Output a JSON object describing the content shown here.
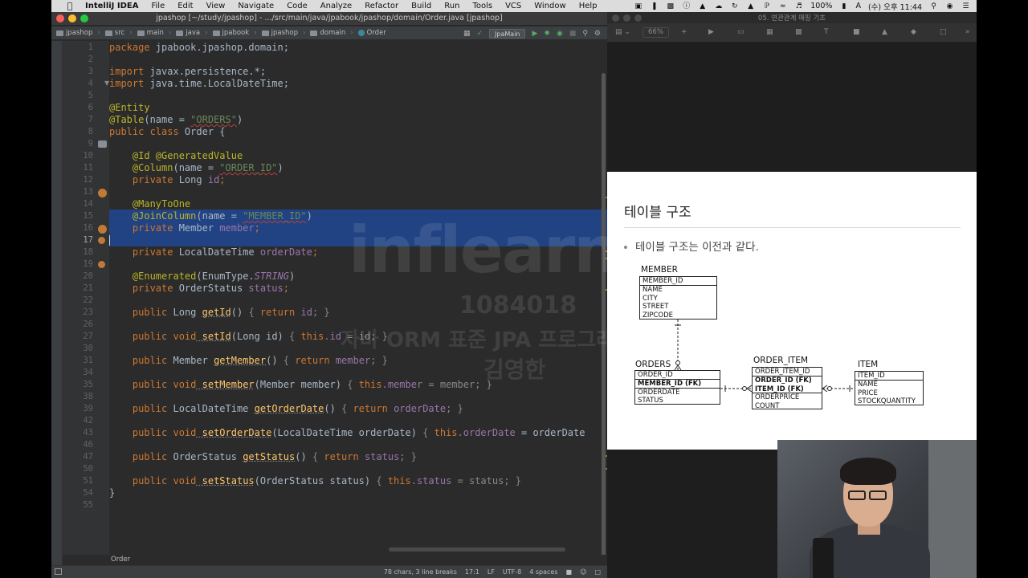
{
  "menubar": {
    "app_name": "IntelliJ IDEA",
    "items": [
      "File",
      "Edit",
      "View",
      "Navigate",
      "Code",
      "Analyze",
      "Refactor",
      "Build",
      "Run",
      "Tools",
      "VCS",
      "Window",
      "Help"
    ],
    "battery": "100%",
    "input_method": "A",
    "clock": "(수) 오후 11:44"
  },
  "ide": {
    "title": "jpashop [~/study/jpashop] - .../src/main/java/jpabook/jpashop/domain/Order.java [jpashop]",
    "breadcrumbs": [
      "jpashop",
      "src",
      "main",
      "java",
      "jpabook",
      "jpashop",
      "domain",
      "Order"
    ],
    "run_config": "JpaMain",
    "tab_label": "Order",
    "status": {
      "selection": "78 chars, 3 line breaks",
      "position": "17:1",
      "line_sep": "LF",
      "encoding": "UTF-8",
      "indent": "4 spaces"
    },
    "line_numbers": [
      "1",
      "2",
      "3",
      "4",
      "5",
      "6",
      "7",
      "8",
      "9",
      "10",
      "11",
      "12",
      "13",
      "14",
      "15",
      "16",
      "17",
      "18",
      "19",
      "20",
      "21",
      "22",
      "23",
      "26",
      "27",
      "30",
      "31",
      "34",
      "35",
      "38",
      "39",
      "42",
      "43",
      "46",
      "47",
      "50",
      "51",
      "54",
      "55"
    ]
  },
  "code": {
    "l1_kw": "package",
    "l1_rest": " jpabook.jpashop.domain;",
    "l3_kw": "import",
    "l3_rest": " javax.persistence.*;",
    "l4_kw": "import",
    "l4_rest": " java.time.LocalDateTime;",
    "l6": "@Entity",
    "l7_ann": "@Table",
    "l7_a": "(name = ",
    "l7_str": "\"ORDERS\"",
    "l7_b": ")",
    "l8_kw": "public class",
    "l8_rest": " Order {",
    "l10": "@Id @GeneratedValue",
    "l11_ann": "@Column",
    "l11_a": "(name = ",
    "l11_str": "\"ORDER_ID\"",
    "l11_b": ")",
    "l12_kw": "private",
    "l12_type": " Long ",
    "l12_f": "id",
    "l12_end": ";",
    "l14": "@ManyToOne",
    "l15_ann": "@JoinColumn",
    "l15_a": "(name = ",
    "l15_str": "\"MEMBER_ID\"",
    "l15_b": ")",
    "l16_kw": "private",
    "l16_type": " Member ",
    "l16_f": "member",
    "l16_end": ";",
    "l18_kw": "private",
    "l18_type": " LocalDateTime ",
    "l18_f": "orderDate",
    "l18_end": ";",
    "l20_ann": "@Enumerated",
    "l20_a": "(EnumType.",
    "l20_const": "STRING",
    "l20_b": ")",
    "l21_kw": "private",
    "l21_type": " OrderStatus ",
    "l21_f": "status",
    "l21_end": ";",
    "g1_kw": "public",
    "g1_type": " Long ",
    "g1_m": "getId",
    "g1_a": "() ",
    "g1_o": "{ ",
    "g1_kw2": "return",
    "g1_f": " id",
    "g1_c": "; }",
    "s1_kw": "public void",
    "s1_m": " setId",
    "s1_a": "(Long id) ",
    "s1_o": "{ ",
    "s1_kw2": "this",
    "s1_f": ".id",
    "s1_c": " = id; }",
    "g2_kw": "public",
    "g2_type": " Member ",
    "g2_m": "getMember",
    "g2_a": "() ",
    "g2_o": "{ ",
    "g2_kw2": "return",
    "g2_f": " member",
    "g2_c": "; }",
    "s2_kw": "public void",
    "s2_m": " setMember",
    "s2_a": "(Member member) ",
    "s2_o": "{ ",
    "s2_kw2": "this",
    "s2_f": ".member",
    "s2_c": " = member; }",
    "g3_kw": "public",
    "g3_type": " LocalDateTime ",
    "g3_m": "getOrderDate",
    "g3_a": "() ",
    "g3_o": "{ ",
    "g3_kw2": "return",
    "g3_f": " orderDate",
    "g3_c": "; }",
    "s3_kw": "public void",
    "s3_m": " setOrderDate",
    "s3_a": "(LocalDateTime orderDate) ",
    "s3_o": "{ ",
    "s3_kw2": "this",
    "s3_f": ".orderDate",
    "s3_c": " = orderDate",
    "g4_kw": "public",
    "g4_type": " OrderStatus ",
    "g4_m": "getStatus",
    "g4_a": "() ",
    "g4_o": "{ ",
    "g4_kw2": "return",
    "g4_f": " status",
    "g4_c": "; }",
    "s4_kw": "public void",
    "s4_m": " setStatus",
    "s4_a": "(OrderStatus status) ",
    "s4_o": "{ ",
    "s4_kw2": "this",
    "s4_f": ".status",
    "s4_c": " = status; }",
    "close": "}"
  },
  "watermark": {
    "logo": "inflearn",
    "number": "1084018",
    "course": "자바 ORM 표준 JPA 프로그래밍 - 기본편",
    "name": "김영한"
  },
  "keynote": {
    "window_title": "05. 연관관계 매핑 기초",
    "zoom": "66%",
    "slide": {
      "title": "테이블 구조",
      "bullet": "테이블 구조는 이전과 같다.",
      "entities": {
        "member": {
          "title": "MEMBER",
          "pk": "MEMBER_ID",
          "cols": [
            "NAME",
            "CITY",
            "STREET",
            "ZIPCODE"
          ]
        },
        "orders": {
          "title": "ORDERS",
          "pk": "ORDER_ID",
          "fks": [
            "MEMBER_ID (FK)"
          ],
          "cols": [
            "ORDERDATE",
            "STATUS"
          ]
        },
        "order_item": {
          "title": "ORDER_ITEM",
          "pk": "ORDER_ITEM_ID",
          "fks": [
            "ORDER_ID (FK)",
            "ITEM_ID (FK)"
          ],
          "cols": [
            "ORDERPRICE",
            "COUNT"
          ]
        },
        "item": {
          "title": "ITEM",
          "pk": "ITEM_ID",
          "cols": [
            "NAME",
            "PRICE",
            "STOCKQUANTITY"
          ]
        }
      }
    }
  },
  "colors": {
    "keyword": "#cc7832",
    "annotation": "#bbb529",
    "string": "#6a8759",
    "field": "#9876aa",
    "method": "#ffc66d",
    "selection": "#214283"
  }
}
